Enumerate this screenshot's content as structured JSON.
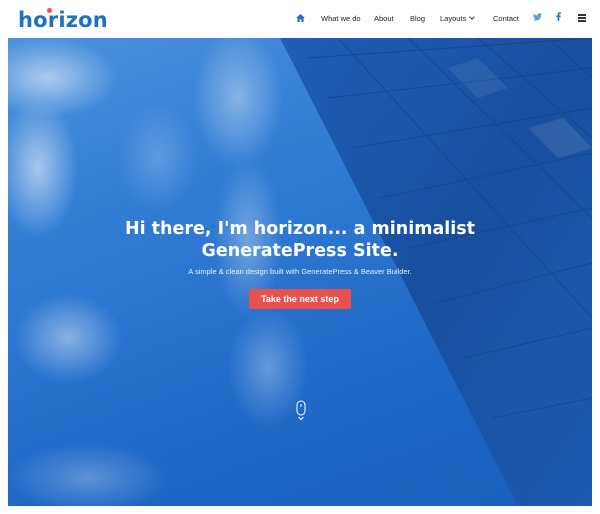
{
  "brand": {
    "logo_text": "horizon"
  },
  "nav": {
    "home_icon": "home-icon",
    "items": [
      {
        "label": "What we do"
      },
      {
        "label": "About"
      },
      {
        "label": "Blog"
      },
      {
        "label": "Layouts"
      },
      {
        "label": "Contact"
      }
    ],
    "social": {
      "twitter_icon": "twitter-icon",
      "facebook_icon": "facebook-icon"
    },
    "menu_icon": "menu-icon"
  },
  "hero": {
    "title_line1": "Hi there, I'm horizon... a minimalist",
    "title_line2": "GeneratePress Site.",
    "subtitle": "A simple & clean design built with GeneratePress & Beaver Builder.",
    "cta_label": "Take the next step",
    "scroll_icon": "scroll-down-icon"
  },
  "colors": {
    "accent": "#1e73be",
    "cta": "#e9514f",
    "hero_sky": "#2f7bd4",
    "hero_building": "#1c52a6"
  }
}
